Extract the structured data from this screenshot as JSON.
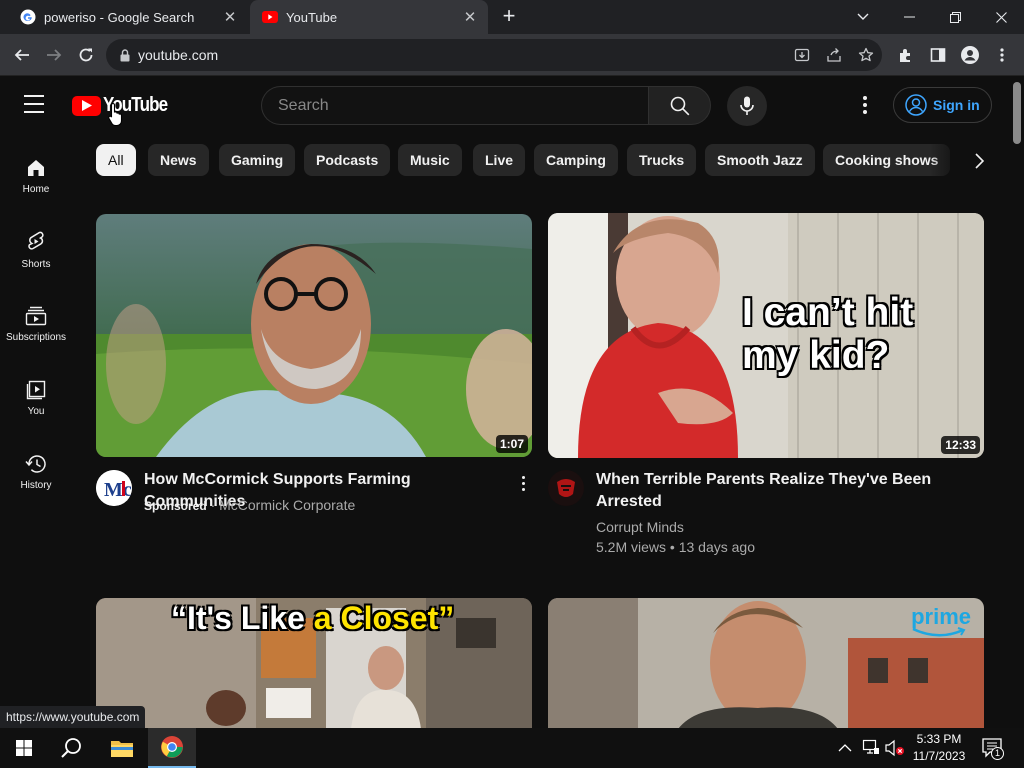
{
  "browser": {
    "tabs": [
      {
        "title": "poweriso - Google Search",
        "active": false
      },
      {
        "title": "YouTube",
        "active": true
      }
    ],
    "url": "youtube.com",
    "status_url": "https://www.youtube.com"
  },
  "header": {
    "logo_text": "YouTube",
    "search_placeholder": "Search",
    "sign_in_label": "Sign in"
  },
  "chips": [
    "All",
    "News",
    "Gaming",
    "Podcasts",
    "Music",
    "Live",
    "Camping",
    "Trucks",
    "Smooth Jazz",
    "Cooking shows"
  ],
  "sidebar": {
    "items": [
      {
        "label": "Home",
        "icon": "home-icon"
      },
      {
        "label": "Shorts",
        "icon": "shorts-icon"
      },
      {
        "label": "Subscriptions",
        "icon": "subscriptions-icon"
      },
      {
        "label": "You",
        "icon": "you-icon"
      },
      {
        "label": "History",
        "icon": "history-icon"
      }
    ]
  },
  "videos": [
    {
      "title": "How McCormick Supports Farming Communities",
      "duration": "1:07",
      "sponsored_label": "Sponsored",
      "channel": "McCormick Corporate",
      "avatar_text": "Mc"
    },
    {
      "title_line1": "When Terrible Parents Realize They've Been",
      "title_line2": "Arrested",
      "duration": "12:33",
      "channel": "Corrupt Minds",
      "meta": "5.2M views • 13 days ago",
      "overlay_line1": "I can’t hit",
      "overlay_line2": "my kid?"
    },
    {
      "overlay_quote_open": "“It's Like",
      "overlay_quote_a": "a",
      "overlay_quote_closet": "Closet”"
    },
    {
      "badge": "prime"
    }
  ],
  "taskbar": {
    "time": "5:33 PM",
    "date": "11/7/2023",
    "notification_count": "1"
  },
  "colors": {
    "yt_red": "#ff0000",
    "link_blue": "#3ea6ff",
    "background": "#0f0f0f"
  }
}
